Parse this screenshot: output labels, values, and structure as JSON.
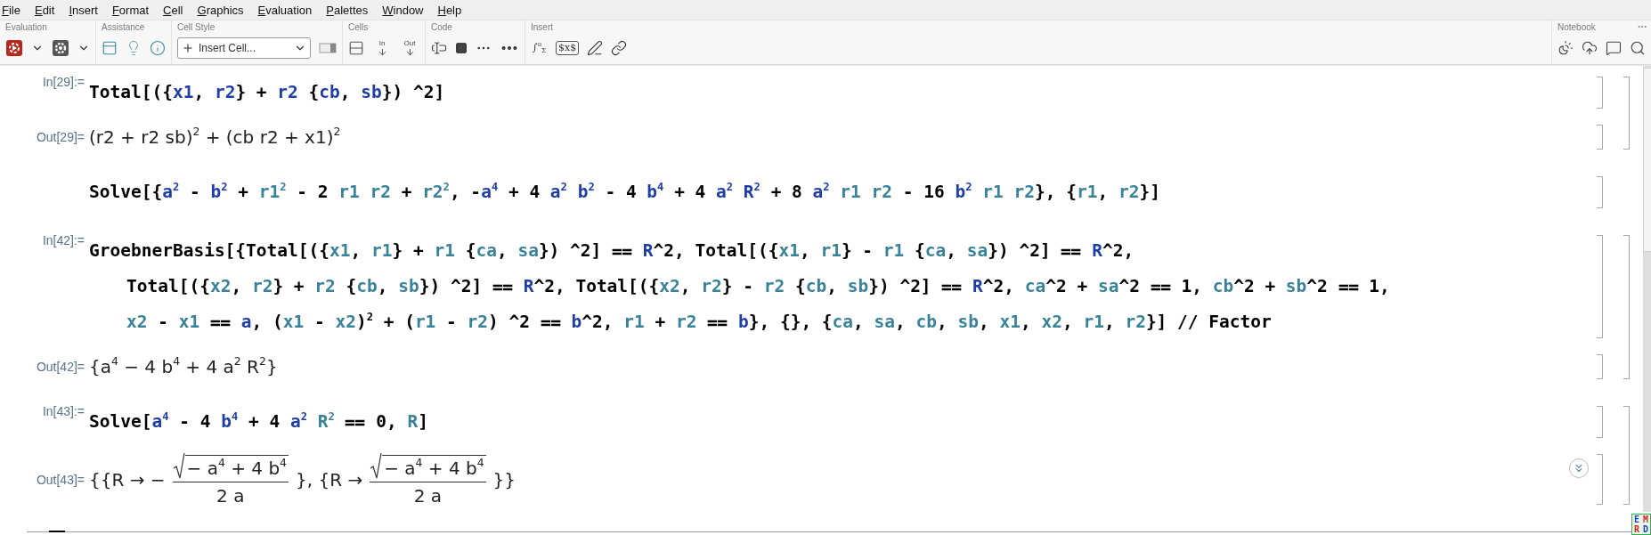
{
  "menu": [
    "File",
    "Edit",
    "Insert",
    "Format",
    "Cell",
    "Graphics",
    "Evaluation",
    "Palettes",
    "Window",
    "Help"
  ],
  "toolbar": {
    "groups": [
      {
        "title": "Evaluation",
        "buttons": [
          {
            "kind": "evaluate"
          },
          {
            "kind": "caret"
          },
          {
            "kind": "gear"
          },
          {
            "kind": "caret"
          }
        ]
      },
      {
        "title": "Assistance",
        "buttons": [
          {
            "kind": "panel"
          },
          {
            "kind": "bulb"
          },
          {
            "kind": "info"
          }
        ]
      },
      {
        "title": "Cell Style",
        "buttons": [
          {
            "kind": "dropdown",
            "text": "Insert Cell..."
          },
          {
            "kind": "window"
          }
        ]
      },
      {
        "title": "Cells",
        "buttons": [
          {
            "kind": "cells"
          },
          {
            "kind": "in",
            "text": "In"
          },
          {
            "kind": "out",
            "text": "Out"
          }
        ]
      },
      {
        "title": "Code",
        "buttons": [
          {
            "kind": "cursor"
          },
          {
            "kind": "square"
          },
          {
            "kind": "dots"
          },
          {
            "kind": "paren"
          }
        ]
      },
      {
        "title": "Insert",
        "buttons": [
          {
            "kind": "typeset",
            "text": "∫$^{π}$$_{Σ}$"
          },
          {
            "kind": "tex",
            "text": "$x$"
          },
          {
            "kind": "pen"
          },
          {
            "kind": "link"
          }
        ]
      }
    ],
    "right_groups": [
      {
        "title": "Notebook",
        "buttons": [
          {
            "kind": "sunmoon"
          },
          {
            "kind": "cloud"
          },
          {
            "kind": "chat"
          },
          {
            "kind": "search"
          }
        ]
      }
    ]
  },
  "groups": [
    {
      "cells": [
        {
          "kind": "input",
          "label": "In[29]:=",
          "lines": [
            [
              {
                "kind": "plain",
                "text": "Total[({"
              },
              {
                "kind": "global",
                "text": "x1"
              },
              {
                "kind": "plain",
                "text": ", "
              },
              {
                "kind": "global",
                "text": "r2"
              },
              {
                "kind": "plain",
                "text": "} + "
              },
              {
                "kind": "global",
                "text": "r2"
              },
              {
                "kind": "plain",
                "text": " {"
              },
              {
                "kind": "global",
                "text": "cb"
              },
              {
                "kind": "plain",
                "text": ", "
              },
              {
                "kind": "global",
                "text": "sb"
              },
              {
                "kind": "plain",
                "text": "}) ^2]"
              }
            ]
          ]
        },
        {
          "kind": "output",
          "label": "Out[29]=",
          "parts": [
            {
              "kind": "text",
              "text": "(r2 + r2 sb)$^{2}$ + (cb r2 + x1)$^{2}$"
            }
          ]
        }
      ]
    },
    {
      "cells": [
        {
          "kind": "input",
          "lines": [
            [
              {
                "kind": "plain",
                "text": "Solve[{"
              },
              {
                "kind": "global",
                "text": "a$^{2}$"
              },
              {
                "kind": "plain",
                "text": " - "
              },
              {
                "kind": "global",
                "text": "b$^{2}$"
              },
              {
                "kind": "plain",
                "text": " + "
              },
              {
                "kind": "local",
                "text": "r1$^{2}$"
              },
              {
                "kind": "plain",
                "text": " - 2 "
              },
              {
                "kind": "local",
                "text": "r1 r2"
              },
              {
                "kind": "plain",
                "text": " + "
              },
              {
                "kind": "local",
                "text": "r2$^{2}$"
              },
              {
                "kind": "plain",
                "text": ", -"
              },
              {
                "kind": "global",
                "text": "a$^{4}$"
              },
              {
                "kind": "plain",
                "text": " + 4 "
              },
              {
                "kind": "global",
                "text": "a$^{2}$ b$^{2}$"
              },
              {
                "kind": "plain",
                "text": " - 4 "
              },
              {
                "kind": "global",
                "text": "b$^{4}$"
              },
              {
                "kind": "plain",
                "text": " + 4 "
              },
              {
                "kind": "global",
                "text": "a$^{2}$ R$^{2}$"
              },
              {
                "kind": "plain",
                "text": " + 8 "
              },
              {
                "kind": "global",
                "text": "a$^{2}$"
              },
              {
                "kind": "local",
                "text": " r1 r2"
              },
              {
                "kind": "plain",
                "text": " - 16 "
              },
              {
                "kind": "global",
                "text": "b$^{2}$"
              },
              {
                "kind": "local",
                "text": " r1 r2"
              },
              {
                "kind": "plain",
                "text": "}, {"
              },
              {
                "kind": "local",
                "text": "r1"
              },
              {
                "kind": "plain",
                "text": ", "
              },
              {
                "kind": "local",
                "text": "r2"
              },
              {
                "kind": "plain",
                "text": "}]"
              }
            ]
          ]
        }
      ]
    },
    {
      "cells": [
        {
          "kind": "input",
          "label": "In[42]:=",
          "lines": [
            [
              {
                "kind": "plain",
                "text": "GroebnerBasis[{Total[({"
              },
              {
                "kind": "local",
                "text": "x1"
              },
              {
                "kind": "plain",
                "text": ", "
              },
              {
                "kind": "local",
                "text": "r1"
              },
              {
                "kind": "plain",
                "text": "} + "
              },
              {
                "kind": "local",
                "text": "r1"
              },
              {
                "kind": "plain",
                "text": " {"
              },
              {
                "kind": "local",
                "text": "ca"
              },
              {
                "kind": "plain",
                "text": ", "
              },
              {
                "kind": "local",
                "text": "sa"
              },
              {
                "kind": "plain",
                "text": "}) ^2] ⩵ "
              },
              {
                "kind": "global",
                "text": "R"
              },
              {
                "kind": "plain",
                "text": "^2, Total[({"
              },
              {
                "kind": "local",
                "text": "x1"
              },
              {
                "kind": "plain",
                "text": ", "
              },
              {
                "kind": "local",
                "text": "r1"
              },
              {
                "kind": "plain",
                "text": "} - "
              },
              {
                "kind": "local",
                "text": "r1"
              },
              {
                "kind": "plain",
                "text": " {"
              },
              {
                "kind": "local",
                "text": "ca"
              },
              {
                "kind": "plain",
                "text": ", "
              },
              {
                "kind": "local",
                "text": "sa"
              },
              {
                "kind": "plain",
                "text": "}) ^2] ⩵ "
              },
              {
                "kind": "global",
                "text": "R"
              },
              {
                "kind": "plain",
                "text": "^2,"
              }
            ],
            [
              {
                "kind": "plain",
                "text": "Total[({"
              },
              {
                "kind": "local",
                "text": "x2"
              },
              {
                "kind": "plain",
                "text": ", "
              },
              {
                "kind": "local",
                "text": "r2"
              },
              {
                "kind": "plain",
                "text": "} + "
              },
              {
                "kind": "local",
                "text": "r2"
              },
              {
                "kind": "plain",
                "text": " {"
              },
              {
                "kind": "local",
                "text": "cb"
              },
              {
                "kind": "plain",
                "text": ", "
              },
              {
                "kind": "local",
                "text": "sb"
              },
              {
                "kind": "plain",
                "text": "}) ^2] ⩵ "
              },
              {
                "kind": "global",
                "text": "R"
              },
              {
                "kind": "plain",
                "text": "^2, Total[({"
              },
              {
                "kind": "local",
                "text": "x2"
              },
              {
                "kind": "plain",
                "text": ", "
              },
              {
                "kind": "local",
                "text": "r2"
              },
              {
                "kind": "plain",
                "text": "} - "
              },
              {
                "kind": "local",
                "text": "r2"
              },
              {
                "kind": "plain",
                "text": " {"
              },
              {
                "kind": "local",
                "text": "cb"
              },
              {
                "kind": "plain",
                "text": ", "
              },
              {
                "kind": "local",
                "text": "sb"
              },
              {
                "kind": "plain",
                "text": "}) ^2] ⩵ "
              },
              {
                "kind": "global",
                "text": "R"
              },
              {
                "kind": "plain",
                "text": "^2, "
              },
              {
                "kind": "local",
                "text": "ca"
              },
              {
                "kind": "plain",
                "text": "^2 + "
              },
              {
                "kind": "local",
                "text": "sa"
              },
              {
                "kind": "plain",
                "text": "^2 ⩵ 1, "
              },
              {
                "kind": "local",
                "text": "cb"
              },
              {
                "kind": "plain",
                "text": "^2 + "
              },
              {
                "kind": "local",
                "text": "sb"
              },
              {
                "kind": "plain",
                "text": "^2 ⩵ 1,"
              }
            ],
            [
              {
                "kind": "local",
                "text": "x2"
              },
              {
                "kind": "plain",
                "text": " - "
              },
              {
                "kind": "local",
                "text": "x1"
              },
              {
                "kind": "plain",
                "text": " ⩵ "
              },
              {
                "kind": "global",
                "text": "a"
              },
              {
                "kind": "plain",
                "text": ", ("
              },
              {
                "kind": "local",
                "text": "x1"
              },
              {
                "kind": "plain",
                "text": " - "
              },
              {
                "kind": "local",
                "text": "x2"
              },
              {
                "kind": "plain",
                "text": ")$^{2}$ + ("
              },
              {
                "kind": "local",
                "text": "r1"
              },
              {
                "kind": "plain",
                "text": " - "
              },
              {
                "kind": "local",
                "text": "r2"
              },
              {
                "kind": "plain",
                "text": ") ^2 ⩵ "
              },
              {
                "kind": "global",
                "text": "b"
              },
              {
                "kind": "plain",
                "text": "^2, "
              },
              {
                "kind": "local",
                "text": "r1"
              },
              {
                "kind": "plain",
                "text": " + "
              },
              {
                "kind": "local",
                "text": "r2"
              },
              {
                "kind": "plain",
                "text": " ⩵ "
              },
              {
                "kind": "global",
                "text": "b"
              },
              {
                "kind": "plain",
                "text": "}, {}, {"
              },
              {
                "kind": "local",
                "text": "ca"
              },
              {
                "kind": "plain",
                "text": ", "
              },
              {
                "kind": "local",
                "text": "sa"
              },
              {
                "kind": "plain",
                "text": ", "
              },
              {
                "kind": "local",
                "text": "cb"
              },
              {
                "kind": "plain",
                "text": ", "
              },
              {
                "kind": "local",
                "text": "sb"
              },
              {
                "kind": "plain",
                "text": ", "
              },
              {
                "kind": "local",
                "text": "x1"
              },
              {
                "kind": "plain",
                "text": ", "
              },
              {
                "kind": "local",
                "text": "x2"
              },
              {
                "kind": "plain",
                "text": ", "
              },
              {
                "kind": "local",
                "text": "r1"
              },
              {
                "kind": "plain",
                "text": ", "
              },
              {
                "kind": "local",
                "text": "r2"
              },
              {
                "kind": "plain",
                "text": "}] // Factor"
              }
            ]
          ]
        },
        {
          "kind": "output",
          "label": "Out[42]=",
          "parts": [
            {
              "kind": "text",
              "text": "{a$^{4}$ − 4 b$^{4}$ + 4 a$^{2}$ R$^{2}$}"
            }
          ]
        }
      ]
    },
    {
      "cells": [
        {
          "kind": "input",
          "label": "In[43]:=",
          "lines": [
            [
              {
                "kind": "plain",
                "text": "Solve["
              },
              {
                "kind": "global",
                "text": "a$^{4}$"
              },
              {
                "kind": "plain",
                "text": " - 4 "
              },
              {
                "kind": "global",
                "text": "b$^{4}$"
              },
              {
                "kind": "plain",
                "text": " + 4 "
              },
              {
                "kind": "global",
                "text": "a$^{2}$"
              },
              {
                "kind": "local",
                "text": " R$^{2}$"
              },
              {
                "kind": "plain",
                "text": " ⩵ 0, "
              },
              {
                "kind": "local",
                "text": "R"
              },
              {
                "kind": "plain",
                "text": "]"
              }
            ]
          ]
        },
        {
          "kind": "output",
          "label": "Out[43]=",
          "parts": [
            {
              "kind": "text",
              "text": "{{R → −"
            },
            {
              "kind": "fraction",
              "root": true,
              "numerator": "− a$^{4}$ + 4 b$^{4}$",
              "denominator": "2 a"
            },
            {
              "kind": "text",
              "text": "}, {R →"
            },
            {
              "kind": "fraction",
              "root": true,
              "numerator": "− a$^{4}$ + 4 b$^{4}$",
              "denominator": "2 a"
            },
            {
              "kind": "text",
              "text": "}}"
            }
          ]
        }
      ]
    }
  ],
  "corner_badge": [
    {
      "text": "E",
      "color": "#1c3fc4"
    },
    {
      "text": "M",
      "color": "#d42020"
    },
    {
      "text": "R",
      "color": "#d42020"
    },
    {
      "text": "D",
      "color": "#1c3fc4"
    }
  ]
}
